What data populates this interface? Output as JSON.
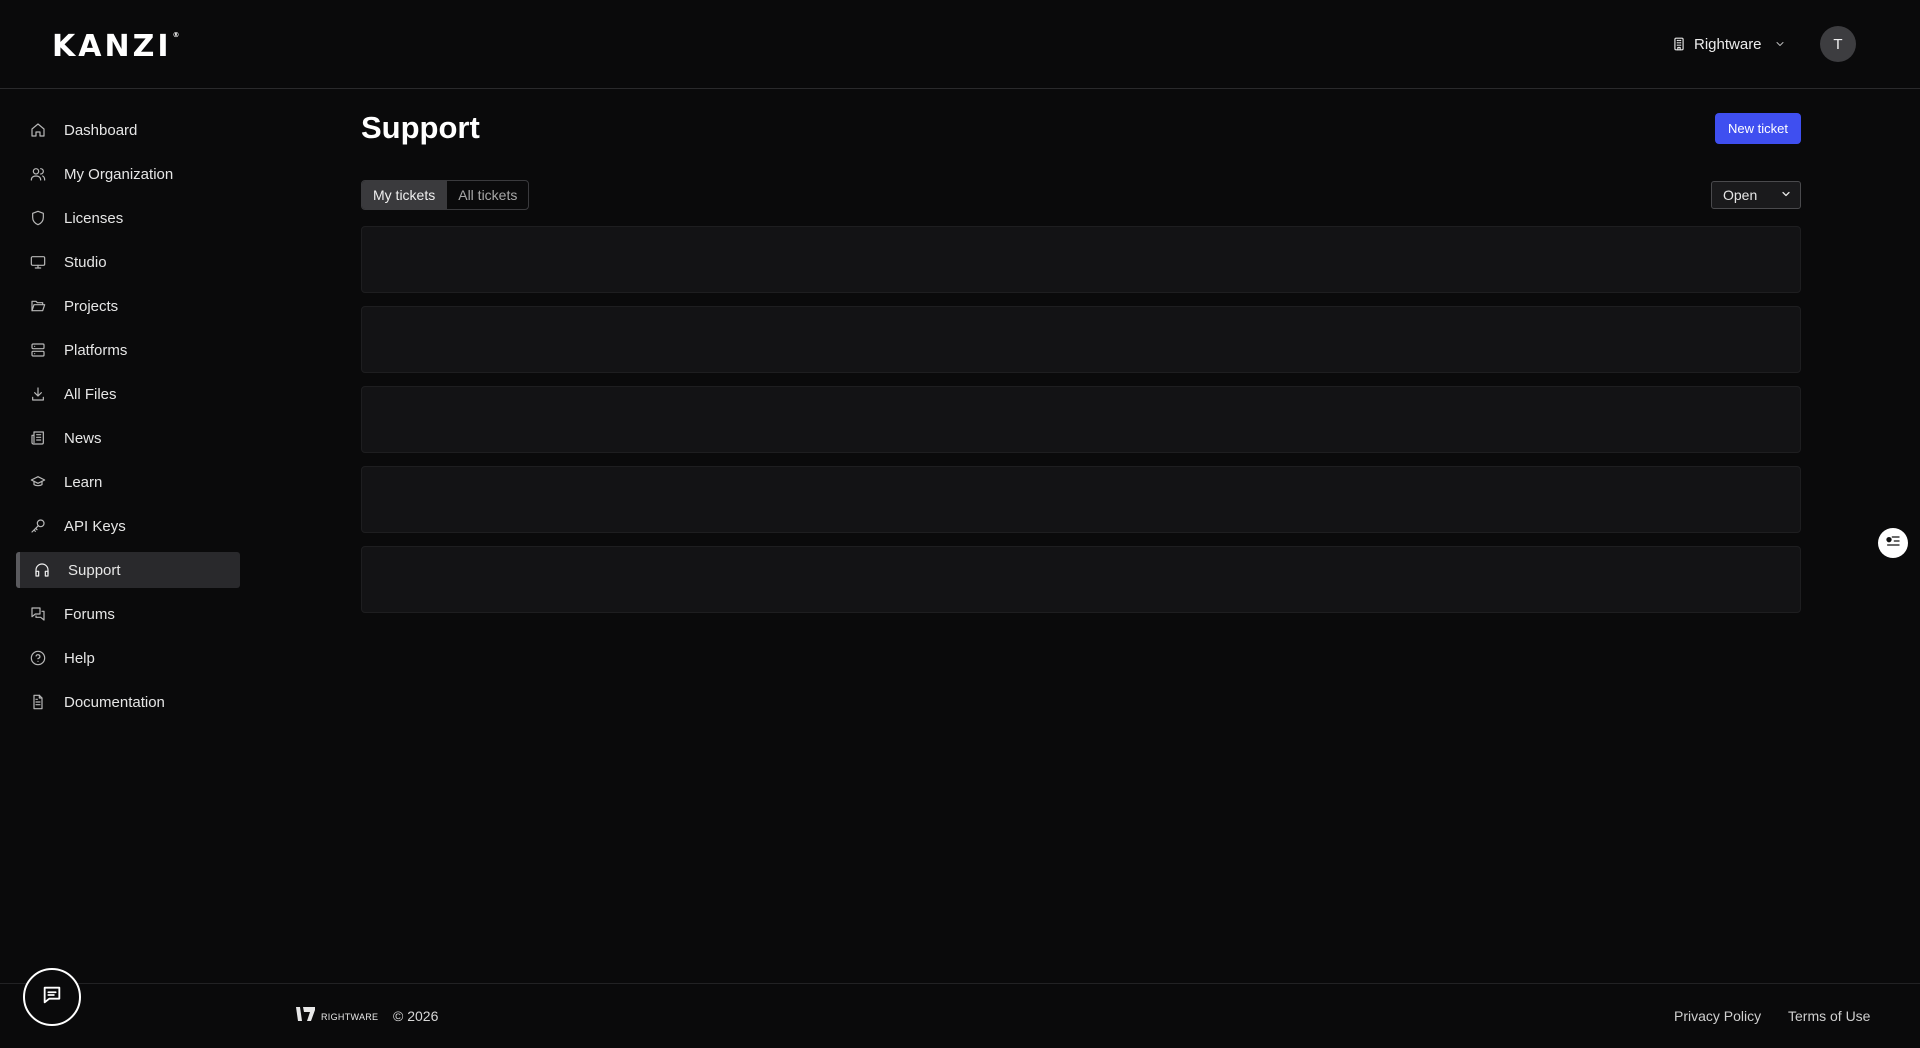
{
  "header": {
    "logo": "KANZI",
    "logo_mark": "®",
    "org_name": "Rightware",
    "avatar_initial": "T"
  },
  "sidebar": {
    "items": [
      {
        "label": "Dashboard",
        "icon": "home-icon"
      },
      {
        "label": "My Organization",
        "icon": "users-icon"
      },
      {
        "label": "Licenses",
        "icon": "shield-icon"
      },
      {
        "label": "Studio",
        "icon": "monitor-icon"
      },
      {
        "label": "Projects",
        "icon": "folder-open-icon"
      },
      {
        "label": "Platforms",
        "icon": "server-icon"
      },
      {
        "label": "All Files",
        "icon": "download-icon"
      },
      {
        "label": "News",
        "icon": "newspaper-icon"
      },
      {
        "label": "Learn",
        "icon": "graduation-cap-icon"
      },
      {
        "label": "API Keys",
        "icon": "key-icon"
      },
      {
        "label": "Support",
        "icon": "headphones-icon",
        "active": true
      },
      {
        "label": "Forums",
        "icon": "messages-icon"
      },
      {
        "label": "Help",
        "icon": "help-circle-icon"
      },
      {
        "label": "Documentation",
        "icon": "file-text-icon"
      }
    ]
  },
  "main": {
    "title": "Support",
    "new_ticket_label": "New ticket",
    "tabs": [
      {
        "label": "My tickets",
        "active": true
      },
      {
        "label": "All tickets",
        "active": false
      }
    ],
    "status_filter": "Open"
  },
  "footer": {
    "brand": "RIGHTWARE",
    "copyright": "© 2026",
    "privacy": "Privacy Policy",
    "terms": "Terms of Use"
  },
  "colors": {
    "background": "#0a0a0b",
    "accent": "#3f4ff0",
    "active_nav": "#29292c",
    "skeleton": "#131315"
  }
}
